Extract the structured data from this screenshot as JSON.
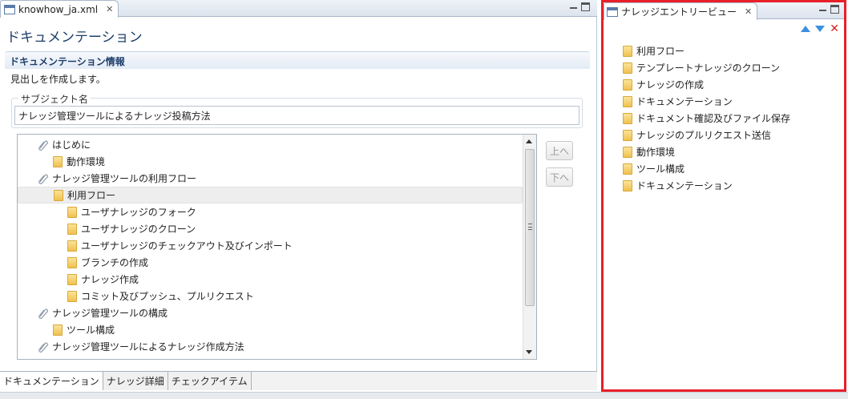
{
  "editor": {
    "tab_title": "knowhow_ja.xml",
    "page_title": "ドキュメンテーション",
    "section_title": "ドキュメンテーション情報",
    "section_desc": "見出しを作成します。",
    "subject_label": "サブジェクト名",
    "subject_value": "ナレッジ管理ツールによるナレッジ投稿方法",
    "tree": [
      {
        "label": "はじめに",
        "icon": "paperclip-icon",
        "level": 0
      },
      {
        "label": "動作環境",
        "icon": "folder-icon",
        "level": 1
      },
      {
        "label": "ナレッジ管理ツールの利用フロー",
        "icon": "paperclip-icon",
        "level": 0
      },
      {
        "label": "利用フロー",
        "icon": "folder-icon",
        "level": 1,
        "selected": true
      },
      {
        "label": "ユーザナレッジのフォーク",
        "icon": "folder-icon",
        "level": 2
      },
      {
        "label": "ユーザナレッジのクローン",
        "icon": "folder-icon",
        "level": 2
      },
      {
        "label": "ユーザナレッジのチェックアウト及びインポート",
        "icon": "folder-icon",
        "level": 2
      },
      {
        "label": "ブランチの作成",
        "icon": "folder-icon",
        "level": 2
      },
      {
        "label": "ナレッジ作成",
        "icon": "folder-icon",
        "level": 2
      },
      {
        "label": "コミット及びプッシュ、プルリクエスト",
        "icon": "folder-icon",
        "level": 2
      },
      {
        "label": "ナレッジ管理ツールの構成",
        "icon": "paperclip-icon",
        "level": 0
      },
      {
        "label": "ツール構成",
        "icon": "folder-icon",
        "level": 1
      },
      {
        "label": "ナレッジ管理ツールによるナレッジ作成方法",
        "icon": "paperclip-icon",
        "level": 0
      }
    ],
    "up_button": "上へ",
    "down_button": "下へ",
    "bottom_tabs": [
      "ドキュメンテーション",
      "ナレッジ詳細",
      "チェックアイテム"
    ]
  },
  "view": {
    "tab_title": "ナレッジエントリービュー",
    "items": [
      "利用フロー",
      "テンプレートナレッジのクローン",
      "ナレッジの作成",
      "ドキュメンテーション",
      "ドキュメント確認及びファイル保存",
      "ナレッジのプルリクエスト送信",
      "動作環境",
      "ツール構成",
      "ドキュメンテーション"
    ]
  },
  "colors": {
    "highlight_border": "#e8202a",
    "title_blue": "#1f3f6b",
    "folder_yellow": "#f0c14f",
    "arrow_blue": "#3c8fe0",
    "delete_red": "#d42020"
  }
}
